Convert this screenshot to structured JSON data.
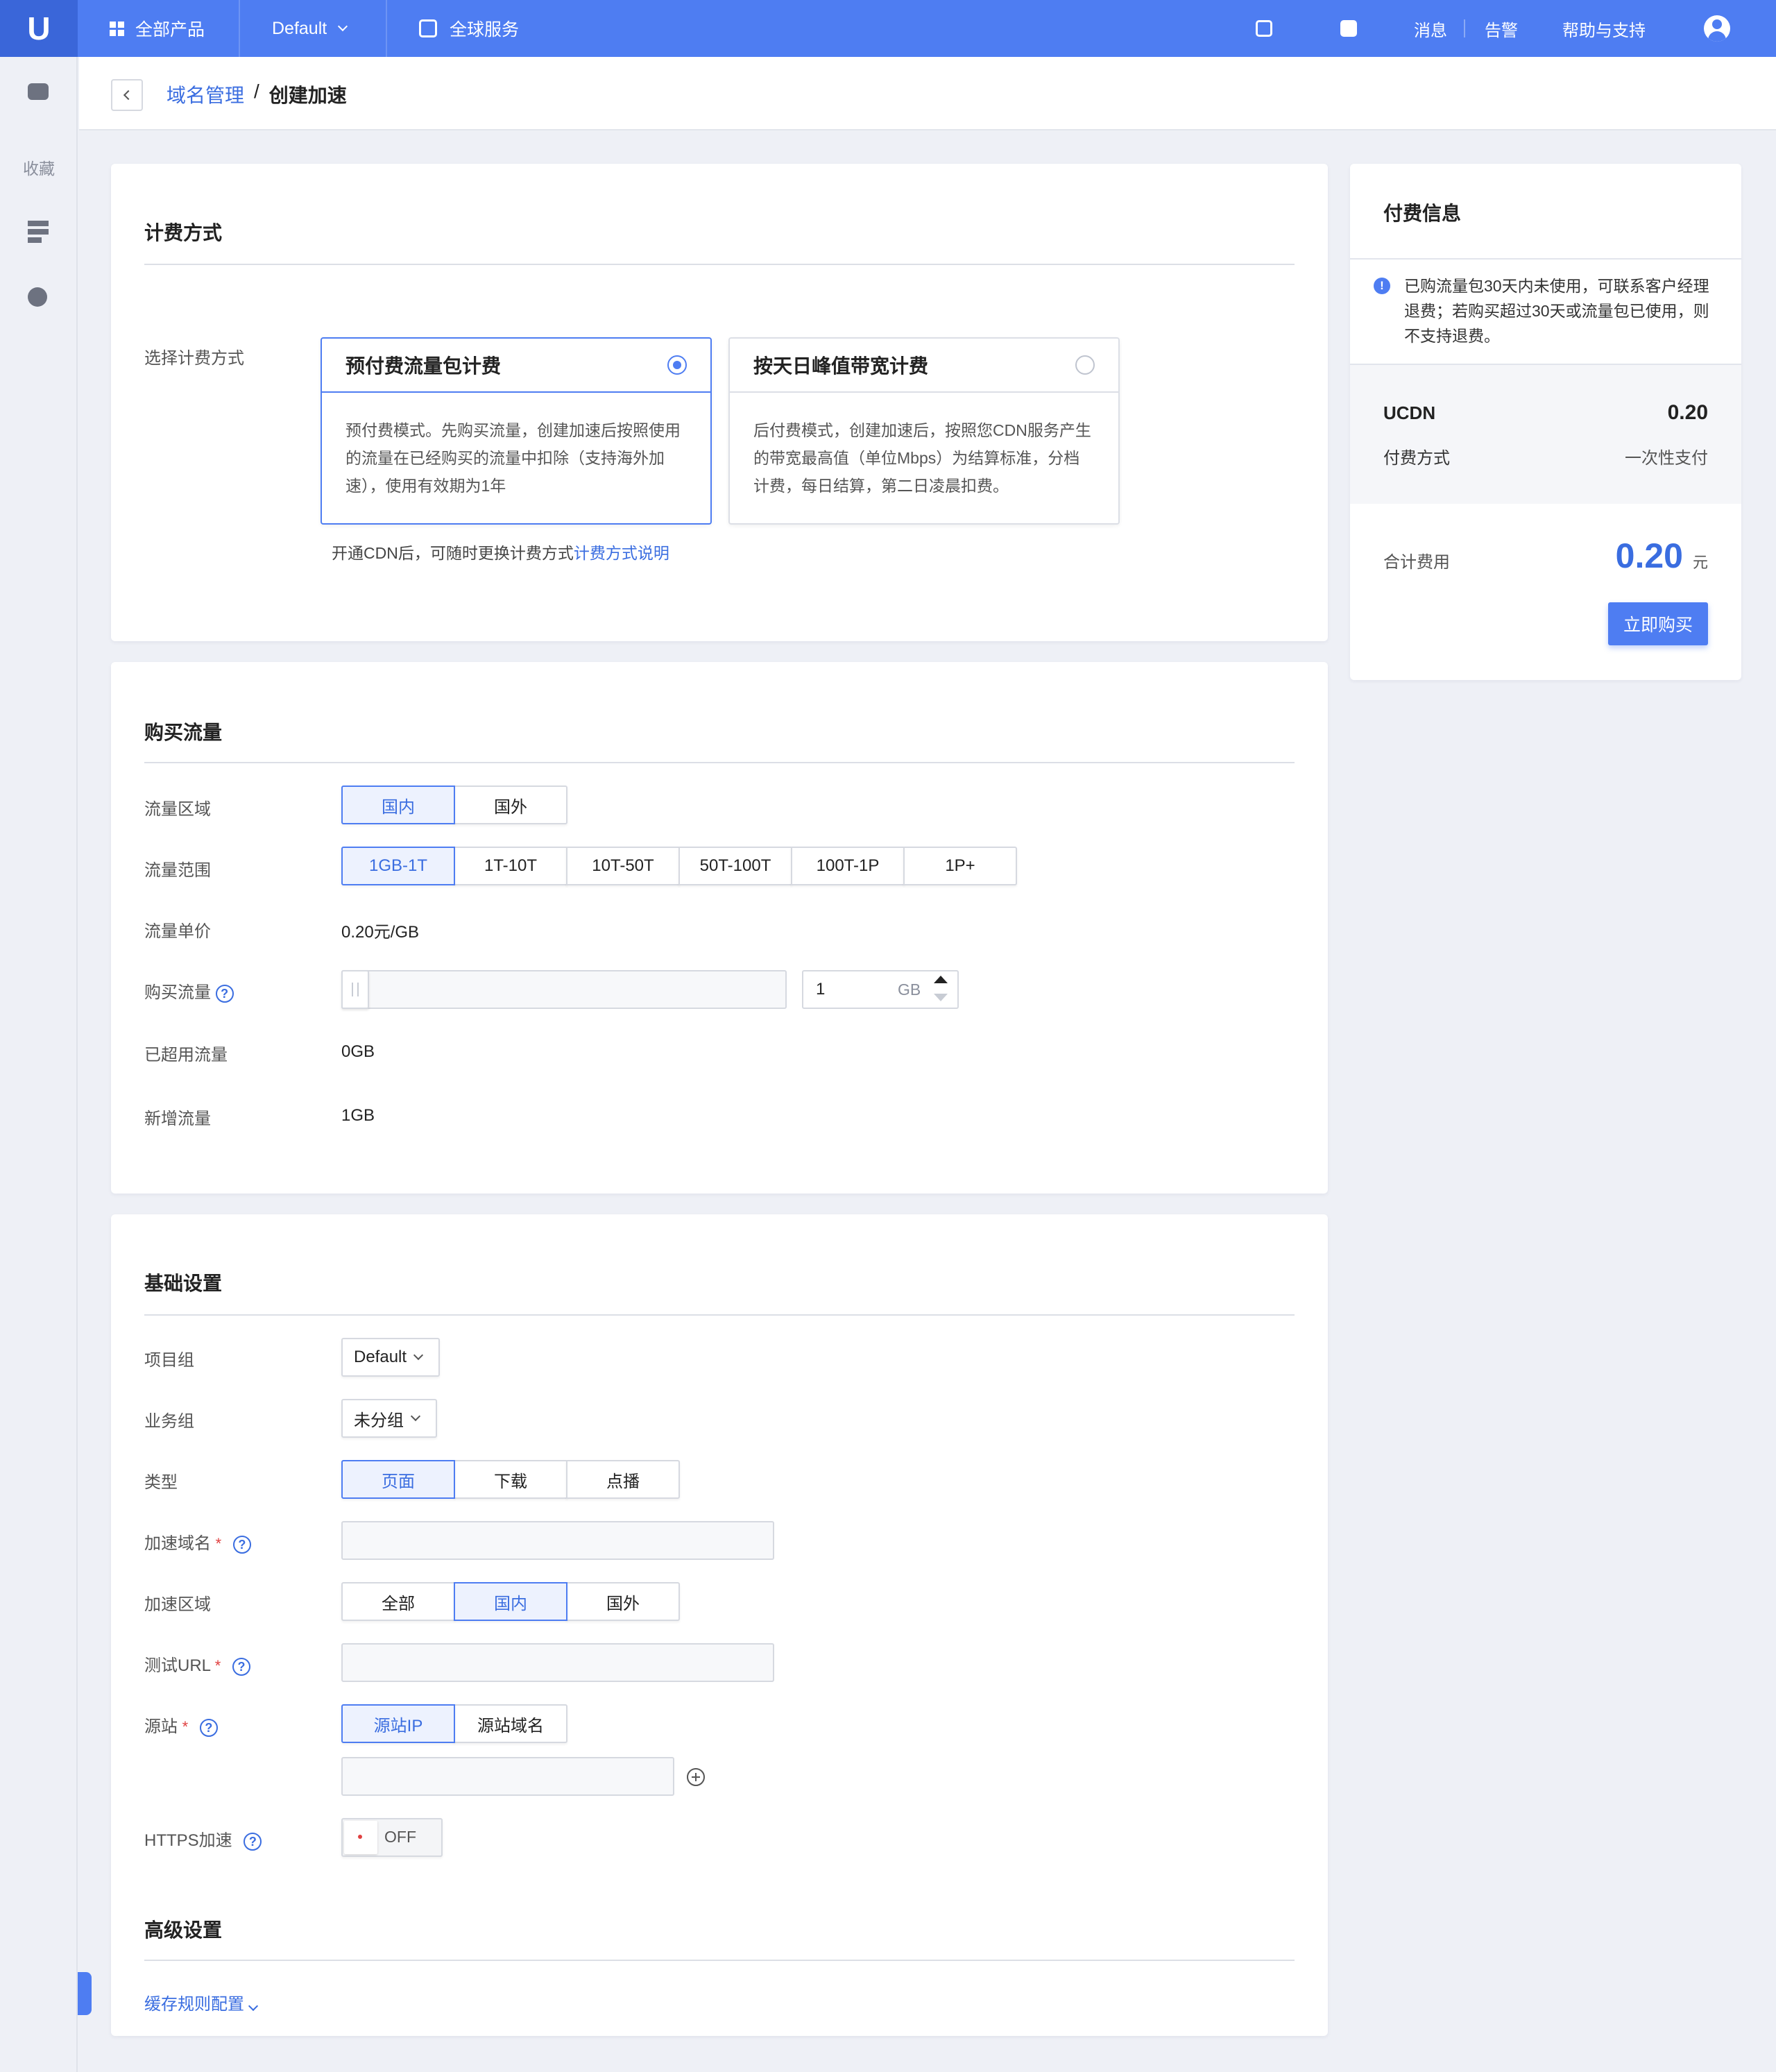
{
  "topbar": {
    "all_products": "全部产品",
    "project": "Default",
    "global_service": "全球服务",
    "messages": "消息",
    "alerts": "告警",
    "help": "帮助与支持"
  },
  "sidebar": {
    "favorites": "收藏"
  },
  "breadcrumb": {
    "parent": "域名管理",
    "sep": "/",
    "current": "创建加速"
  },
  "billing": {
    "title": "计费方式",
    "label": "选择计费方式",
    "plans": [
      {
        "name": "预付费流量包计费",
        "desc": "预付费模式。先购买流量，创建加速后按照使用的流量在已经购买的流量中扣除（支持海外加速），使用有效期为1年",
        "selected": true
      },
      {
        "name": "按天日峰值带宽计费",
        "desc": "后付费模式，创建加速后，按照您CDN服务产生的带宽最高值（单位Mbps）为结算标准，分档计费，每日结算，第二日凌晨扣费。",
        "selected": false
      }
    ],
    "note": "开通CDN后，可随时更换计费方式",
    "note_link": "计费方式说明"
  },
  "purchase": {
    "title": "购买流量",
    "region_label": "流量区域",
    "regions": [
      "国内",
      "国外"
    ],
    "range_label": "流量范围",
    "ranges": [
      "1GB-1T",
      "1T-10T",
      "10T-50T",
      "50T-100T",
      "100T-1P",
      "1P+"
    ],
    "price_label": "流量单价",
    "price": "0.20元/GB",
    "buy_label": "购买流量",
    "buy_value": "1",
    "buy_unit": "GB",
    "buy_slider_fraction": 0,
    "used_label": "已超用流量",
    "used": "0GB",
    "added_label": "新增流量",
    "added": "1GB"
  },
  "basic": {
    "title": "基础设置",
    "project_label": "项目组",
    "project": "Default",
    "biz_label": "业务组",
    "biz": "未分组",
    "type_label": "类型",
    "types": [
      "页面",
      "下载",
      "点播"
    ],
    "domain_label": "加速域名",
    "area_label": "加速区域",
    "areas": [
      "全部",
      "国内",
      "国外"
    ],
    "test_label": "测试URL",
    "origin_label": "源站",
    "origins": [
      "源站IP",
      "源站域名"
    ],
    "https_label": "HTTPS加速",
    "https_state": "OFF",
    "required_mark": "*"
  },
  "advanced": {
    "title": "高级设置",
    "cache_link": "缓存规则配置"
  },
  "payment": {
    "title": "付费信息",
    "notice": "已购流量包30天内未使用，可联系客户经理退费；若购买超过30天或流量包已使用，则不支持退费。",
    "product": "UCDN",
    "product_price": "0.20",
    "method_label": "付费方式",
    "method": "一次性支付",
    "total_label": "合计费用",
    "total": "0.20",
    "currency": "元",
    "buy_button": "立即购买"
  },
  "colors": {
    "accent": "#4e7df2",
    "accent_text": "#3a6de0",
    "required": "#e04040"
  }
}
